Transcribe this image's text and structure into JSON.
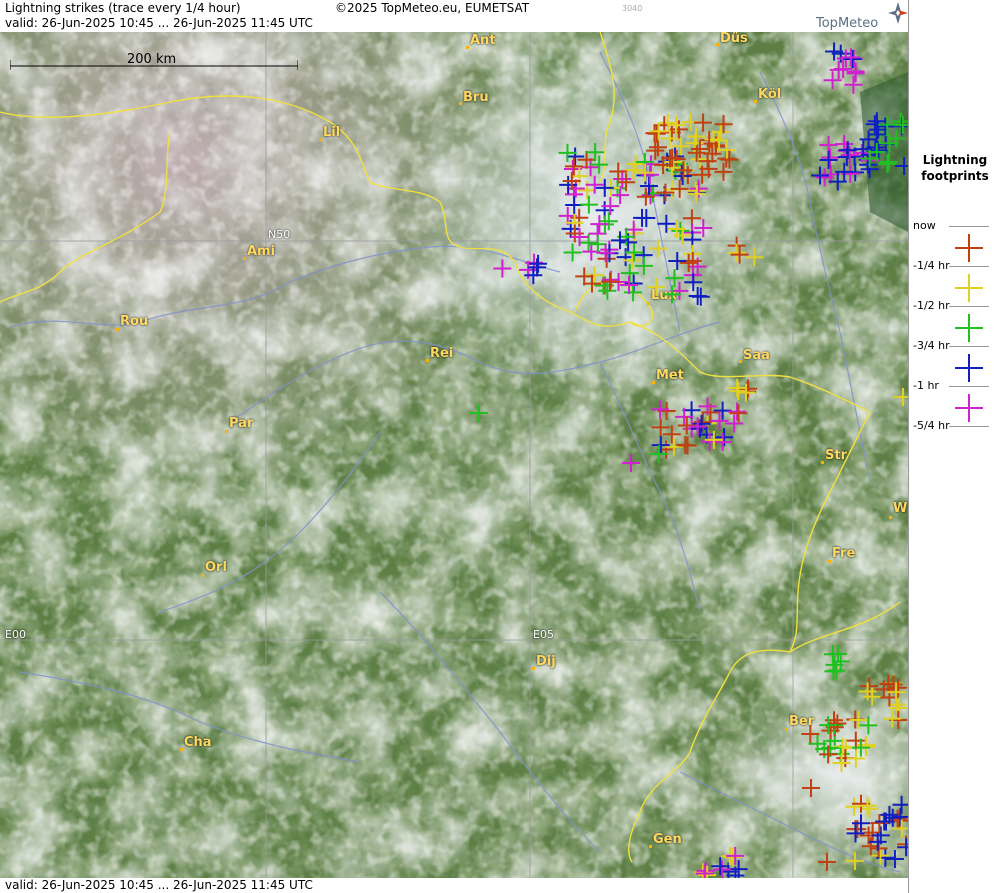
{
  "header": {
    "title": "Lightning strikes (trace every 1/4 hour)",
    "copyright": "©2025 TopMeteo.eu, EUMETSAT",
    "valid": "valid:  26-Jun-2025 10:45 ... 26-Jun-2025 11:45 UTC",
    "code": "3040"
  },
  "logo": {
    "text": "TopMeteo"
  },
  "footer": {
    "valid": "valid:  26-Jun-2025 10:45 ... 26-Jun-2025 11:45 UTC"
  },
  "scale": {
    "label": "200 km"
  },
  "grid_labels": {
    "n50": "N50",
    "e00": "E00",
    "e05": "E05"
  },
  "cities": [
    "Ant",
    "Düs",
    "Bru",
    "Köl",
    "Lil",
    "Ami",
    "Rou",
    "Lux",
    "Rei",
    "Saa",
    "Met",
    "Par",
    "Str",
    "W",
    "Fre",
    "Orl",
    "Dij",
    "Ber",
    "Cha",
    "Gen"
  ],
  "legend": {
    "title_line1": "Lightning",
    "title_line2": "footprints",
    "rows": [
      {
        "label": "now",
        "color": "#c04010"
      },
      {
        "label": "-1/4 hr",
        "color": "#e0d020"
      },
      {
        "label": "-1/2 hr",
        "color": "#20c020"
      },
      {
        "label": "-3/4 hr",
        "color": "#1020c0"
      },
      {
        "label": "-1 hr",
        "color": "#d020d0"
      },
      {
        "label": "-5/4 hr",
        "color": ""
      }
    ]
  },
  "colors": {
    "now": "#c04010",
    "q1": "#e0d020",
    "q2": "#20c020",
    "q3": "#1020c0",
    "q4": "#d020d0",
    "border": "#f0e040",
    "river": "#8090d0",
    "city": "#ffd860"
  }
}
